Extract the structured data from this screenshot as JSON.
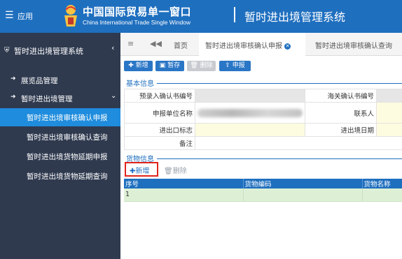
{
  "header": {
    "app_label": "应用",
    "brand_cn": "中国国际贸易单一窗口",
    "brand_en": "China International Trade Single Window",
    "system_title": "暂时进出境管理系统",
    "colors": {
      "header_bg": "#1f6fbf"
    }
  },
  "sidebar": {
    "system_label": "暂时进出境管理系统",
    "items": [
      {
        "label": "展览品管理",
        "icon": "sign-in-icon"
      },
      {
        "label": "暂时进出境管理",
        "icon": "sign-in-icon"
      }
    ],
    "subitems": [
      {
        "label": "暂时进出境审核确认申报",
        "active": true
      },
      {
        "label": "暂时进出境审核确认查询",
        "active": false
      },
      {
        "label": "暂时进出境货物延期申报",
        "active": false
      },
      {
        "label": "暂时进出境货物延期查询",
        "active": false
      }
    ]
  },
  "tabs": {
    "home": "首页",
    "tab1": "暂时进出境审核确认申报",
    "tab2": "暂时进出境审核确认查询"
  },
  "toolbar": {
    "add": "新增",
    "save": "暂存",
    "delete": "删除",
    "submit": "申报"
  },
  "basic_info": {
    "title": "基本信息",
    "fields": {
      "pre_entry_no": "预录入确认书编号",
      "customs_no": "海关确认书编号",
      "declarant": "申报单位名称",
      "contact": "联系人",
      "port_flag": "进出口标志",
      "port_date": "进出境日期",
      "remarks": "备注"
    }
  },
  "goods_info": {
    "title": "货物信息",
    "add": "新增",
    "delete": "删除",
    "columns": [
      "序号",
      "货物编码",
      "货物名称"
    ],
    "rows": [
      [
        "1",
        "",
        ""
      ]
    ]
  }
}
